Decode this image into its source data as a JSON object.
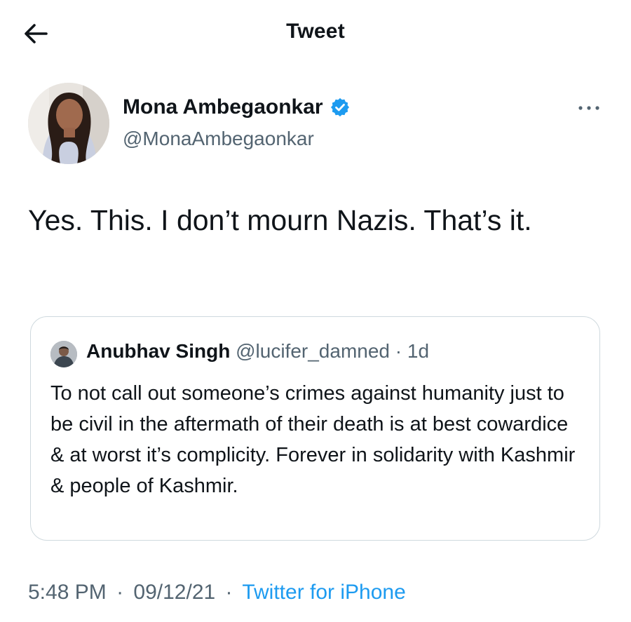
{
  "header": {
    "title": "Tweet",
    "back_icon": "arrow-left-icon"
  },
  "tweet": {
    "author_name": "Mona Ambegaonkar",
    "author_handle": "@MonaAmbegaonkar",
    "verified_icon": "verified-badge-icon",
    "more_icon": "more-horizontal-icon",
    "text": "Yes. This. I don’t mourn Nazis. That’s it.",
    "time": "5:48 PM",
    "date": "09/12/21",
    "source": "Twitter for iPhone",
    "separator": "·"
  },
  "quoted_tweet": {
    "author_name": "Anubhav Singh",
    "author_handle": "@lucifer_damned",
    "separator": "·",
    "age": "1d",
    "text": "To not call out someone’s crimes against humanity just to be civil in the aftermath of their death is at best cowardice & at worst it’s complicity. Forever in solidarity with Kashmir & people of Kashmir."
  },
  "colors": {
    "text": "#0f1419",
    "secondary": "#536471",
    "accent": "#1d9bf0",
    "border": "#cfd9de"
  }
}
